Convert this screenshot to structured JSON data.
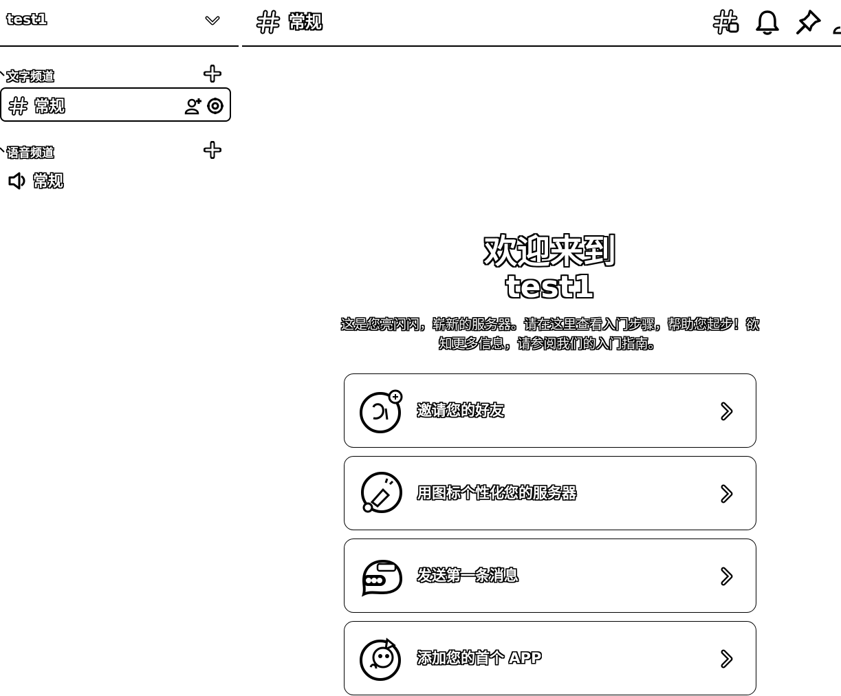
{
  "server": {
    "name": "test1"
  },
  "sidebar": {
    "categories": [
      {
        "label": "文字频道",
        "channels": [
          {
            "label": "常规",
            "type": "text",
            "selected": true
          }
        ]
      },
      {
        "label": "语音频道",
        "channels": [
          {
            "label": "常规",
            "type": "voice",
            "selected": false
          }
        ]
      }
    ]
  },
  "topbar": {
    "channel_title": "常规",
    "icons": [
      "threads-icon",
      "bell-icon",
      "pin-icon",
      "members-icon"
    ]
  },
  "welcome": {
    "title_line1": "欢迎来到",
    "title_line2": "test1",
    "description": "这是您亮闪闪，崭新的服务器。请在这里查看入门步骤，帮助您起步！欲知更多信息，请参阅我们的入门指南。",
    "cards": [
      {
        "label": "邀请您的好友",
        "icon": "invite-friends-icon"
      },
      {
        "label": "用图标个性化您的服务器",
        "icon": "customize-icon"
      },
      {
        "label": "发送第一条消息",
        "icon": "message-icon"
      },
      {
        "label": "添加您的首个 APP",
        "icon": "app-icon"
      }
    ]
  },
  "colors": {
    "background": "#ffffff",
    "outline": "#000000"
  }
}
